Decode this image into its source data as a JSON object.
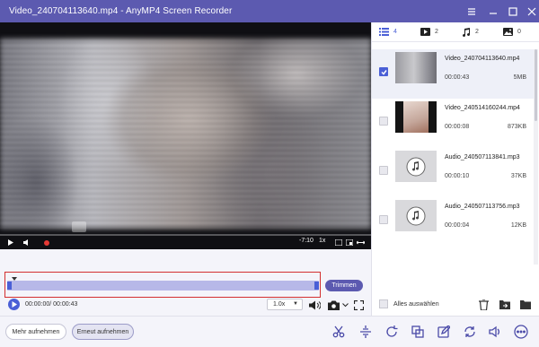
{
  "window": {
    "title": "Video_240704113640.mp4  -  AnyMP4 Screen Recorder",
    "colors": {
      "titlebar": "#5c5ab0",
      "accent": "#4a5fd6",
      "highlight_box": "#d32f2f"
    }
  },
  "player": {
    "video_time_overlay": "-7:10",
    "video_speed_overlay": "1x",
    "current_time": "00:00:00/ 00:00:43",
    "speed_value": "1.0x",
    "trim_label": "Trimmen",
    "progress_fraction": 0.0
  },
  "sidebar": {
    "tabs": [
      {
        "icon": "list-icon",
        "count": "4"
      },
      {
        "icon": "video-play-icon",
        "count": "2"
      },
      {
        "icon": "music-note-icon",
        "count": "2"
      },
      {
        "icon": "image-icon",
        "count": "0"
      }
    ],
    "files": [
      {
        "name": "Video_240704113640.mp4",
        "duration": "00:00:43",
        "size": "5MB",
        "selected": true
      },
      {
        "name": "Video_240514160244.mp4",
        "duration": "00:00:08",
        "size": "873KB",
        "selected": false
      },
      {
        "name": "Audio_240507113841.mp3",
        "duration": "00:00:10",
        "size": "37KB",
        "selected": false
      },
      {
        "name": "Audio_240507113756.mp3",
        "duration": "00:00:04",
        "size": "12KB",
        "selected": false
      }
    ],
    "select_all_label": "Alles auswählen"
  },
  "bottom": {
    "more_record_label": "Mehr aufnehmen",
    "record_again_label": "Erneut aufnehmen",
    "tools": [
      "scissors-icon",
      "split-icon",
      "rotate-icon",
      "merge-icon",
      "edit-icon",
      "convert-icon",
      "volume-icon",
      "more-icon"
    ]
  }
}
